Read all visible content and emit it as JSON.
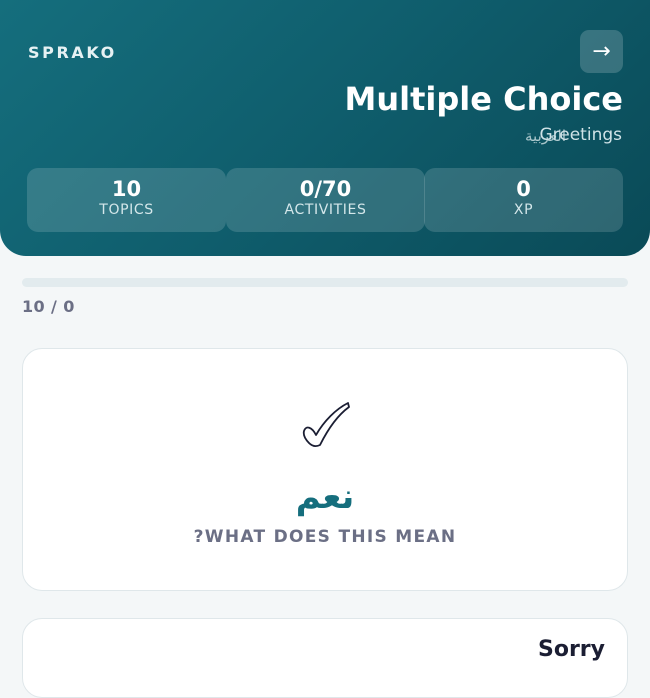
{
  "header": {
    "brand": "SPRAKO",
    "back_icon": "→",
    "title": "Multiple Choice",
    "subtitle": "Greetings",
    "subtitle_script": "العربية"
  },
  "stats": [
    {
      "value": "10",
      "label": "TOPICS"
    },
    {
      "value": "0/70",
      "label": "ACTIVITIES"
    },
    {
      "value": "0",
      "label": "XP"
    }
  ],
  "progress": {
    "text": "10 / 0",
    "fraction": 0
  },
  "question": {
    "icon": "checkmark-icon",
    "word": "نعم",
    "prompt": "?WHAT DOES THIS MEAN"
  },
  "options": [
    {
      "label": "Sorry"
    }
  ],
  "colors": {
    "accent": "#156e7d",
    "header_dark": "#0a4a57",
    "muted_text": "#6b6f85"
  }
}
